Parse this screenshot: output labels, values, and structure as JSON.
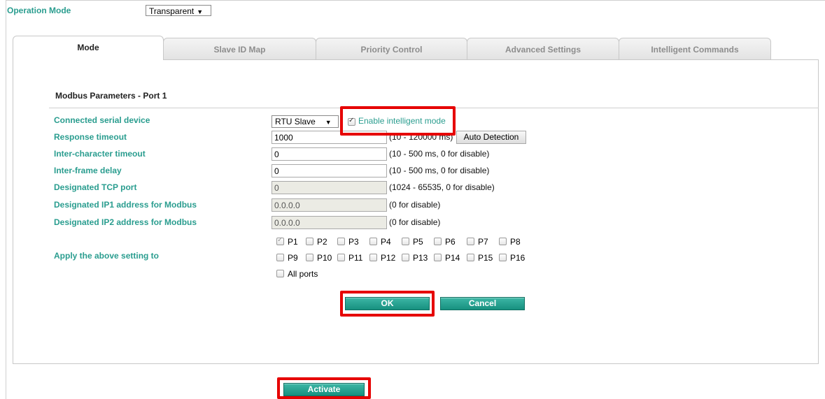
{
  "operation_mode": {
    "label": "Operation Mode",
    "value": "Transparent"
  },
  "tabs": [
    {
      "label": "Mode",
      "active": true
    },
    {
      "label": "Slave ID Map",
      "active": false
    },
    {
      "label": "Priority Control",
      "active": false
    },
    {
      "label": "Advanced Settings",
      "active": false
    },
    {
      "label": "Intelligent Commands",
      "active": false
    }
  ],
  "section": {
    "title": "Modbus Parameters - Port 1"
  },
  "params": {
    "connected_serial_device": {
      "label": "Connected serial device",
      "value": "RTU Slave",
      "intelligent_label": "Enable intelligent mode",
      "intelligent_checked": true
    },
    "response_timeout": {
      "label": "Response timeout",
      "value": "1000",
      "hint": "(10 - 120000 ms)",
      "auto_detect": "Auto Detection"
    },
    "inter_char_timeout": {
      "label": "Inter-character timeout",
      "value": "0",
      "hint": "(10 - 500 ms, 0 for disable)"
    },
    "inter_frame_delay": {
      "label": "Inter-frame delay",
      "value": "0",
      "hint": "(10 - 500 ms, 0 for disable)"
    },
    "tcp_port": {
      "label": "Designated TCP port",
      "value": "0",
      "hint": "(1024 - 65535, 0 for disable)"
    },
    "ip1": {
      "label": "Designated IP1 address for Modbus",
      "value": "0.0.0.0",
      "hint": "(0 for disable)"
    },
    "ip2": {
      "label": "Designated IP2 address for Modbus",
      "value": "0.0.0.0",
      "hint": "(0 for disable)"
    }
  },
  "apply": {
    "label": "Apply the above setting to",
    "ports": [
      {
        "label": "P1",
        "checked": true,
        "disabled": true
      },
      {
        "label": "P2",
        "checked": false
      },
      {
        "label": "P3",
        "checked": false
      },
      {
        "label": "P4",
        "checked": false
      },
      {
        "label": "P5",
        "checked": false
      },
      {
        "label": "P6",
        "checked": false
      },
      {
        "label": "P7",
        "checked": false
      },
      {
        "label": "P8",
        "checked": false
      },
      {
        "label": "P9",
        "checked": false
      },
      {
        "label": "P10",
        "checked": false
      },
      {
        "label": "P11",
        "checked": false
      },
      {
        "label": "P12",
        "checked": false
      },
      {
        "label": "P13",
        "checked": false
      },
      {
        "label": "P14",
        "checked": false
      },
      {
        "label": "P15",
        "checked": false
      },
      {
        "label": "P16",
        "checked": false
      }
    ],
    "all_ports": "All ports"
  },
  "buttons": {
    "ok": "OK",
    "cancel": "Cancel",
    "activate": "Activate"
  },
  "colors": {
    "label_green": "#2a9d8f",
    "button_teal": "#17907f",
    "highlight_red": "#e60000"
  }
}
